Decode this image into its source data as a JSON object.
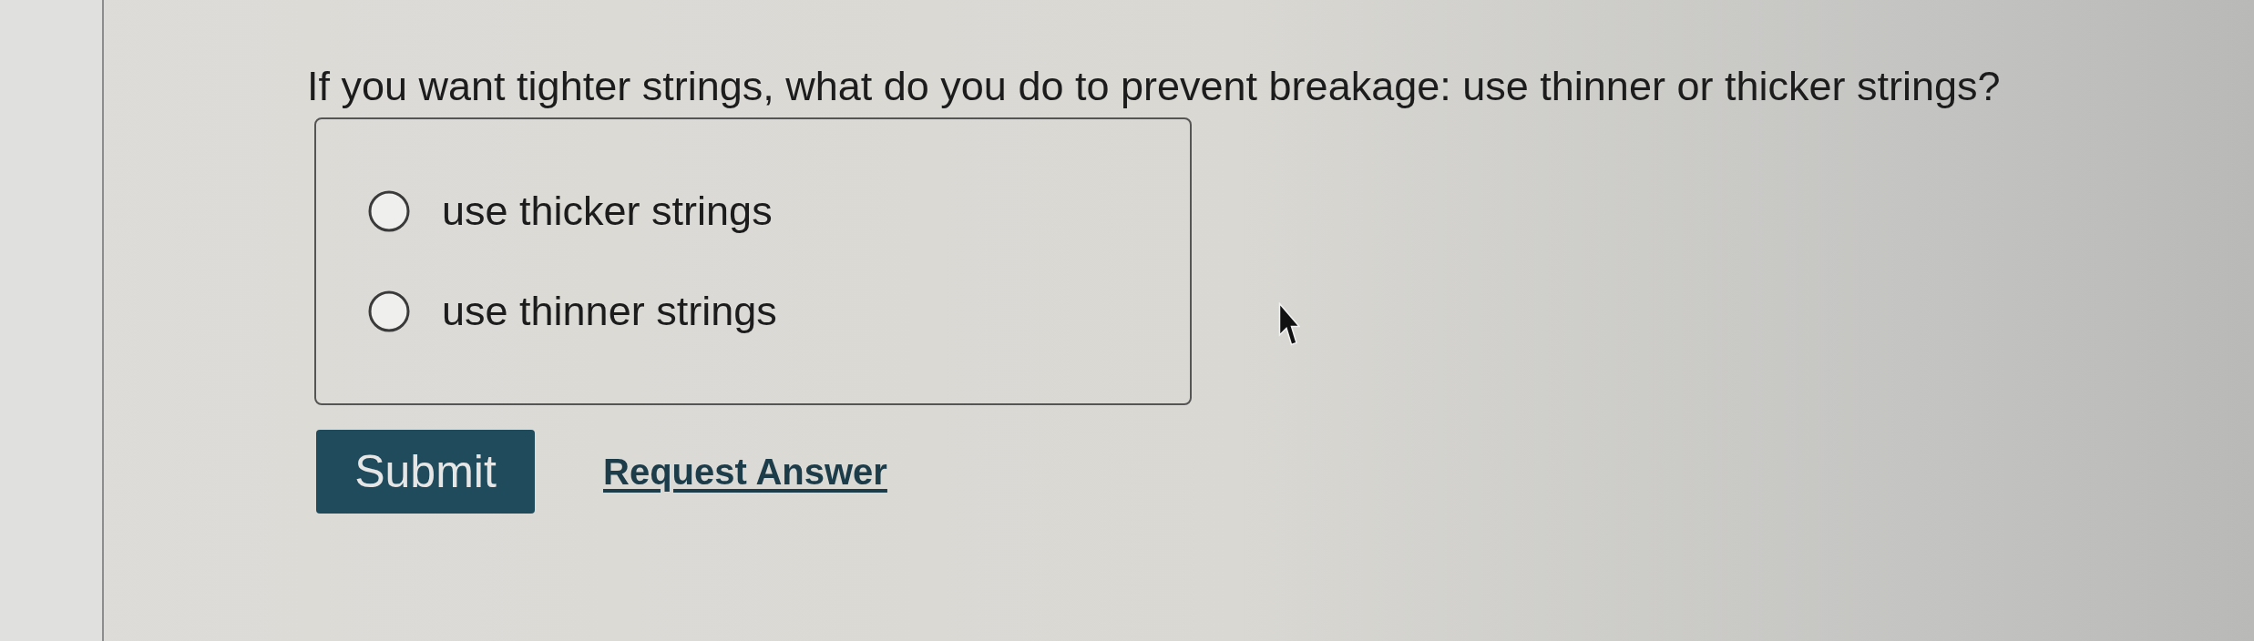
{
  "question": "If you want tighter strings, what do you do to prevent breakage: use thinner or thicker strings?",
  "options": [
    {
      "label": "use thicker strings",
      "selected": false
    },
    {
      "label": "use thinner strings",
      "selected": false
    }
  ],
  "actions": {
    "submit": "Submit",
    "request_answer": "Request Answer"
  }
}
